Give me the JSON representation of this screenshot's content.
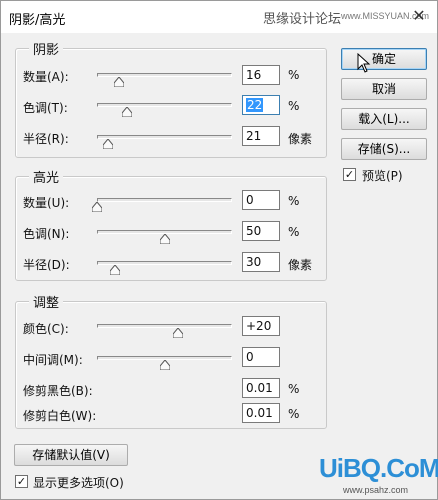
{
  "window": {
    "title": "阴影/高光",
    "watermark_text": "思缘设计论坛",
    "watermark_url": "www.MISSYUAN.com",
    "close_glyph": "✕"
  },
  "shadows": {
    "title": "阴影",
    "rows": [
      {
        "label": "数量(A):",
        "value": "16",
        "unit": "%",
        "level": 0.16
      },
      {
        "label": "色调(T):",
        "value": "22",
        "unit": "%",
        "level": 0.22
      },
      {
        "label": "半径(R):",
        "value": "21",
        "unit": "像素",
        "level": 0.08
      }
    ]
  },
  "highlights": {
    "title": "高光",
    "rows": [
      {
        "label": "数量(U):",
        "value": "0",
        "unit": "%",
        "level": 0.0
      },
      {
        "label": "色调(N):",
        "value": "50",
        "unit": "%",
        "level": 0.5
      },
      {
        "label": "半径(D):",
        "value": "30",
        "unit": "像素",
        "level": 0.13
      }
    ]
  },
  "adjustments": {
    "title": "调整",
    "color": {
      "label": "颜色(C):",
      "value": "+20",
      "level": 0.6
    },
    "midtone": {
      "label": "中间调(M):",
      "value": "0",
      "level": 0.5
    },
    "black_clip": {
      "label": "修剪黑色(B):",
      "value": "0.01",
      "unit": "%"
    },
    "white_clip": {
      "label": "修剪白色(W):",
      "value": "0.01",
      "unit": "%"
    }
  },
  "buttons": {
    "ok": "确定",
    "cancel": "取消",
    "load": "载入(L)...",
    "save": "存储(S)..."
  },
  "preview": {
    "label": "预览(P)",
    "checked": true,
    "check_glyph": "✓"
  },
  "save_defaults": "存储默认值(V)",
  "more_options": {
    "label": "显示更多选项(O)",
    "checked": true,
    "check_glyph": "✓"
  },
  "logo": {
    "text": "UiBQ.CoM",
    "url": "www.psahz.com"
  }
}
